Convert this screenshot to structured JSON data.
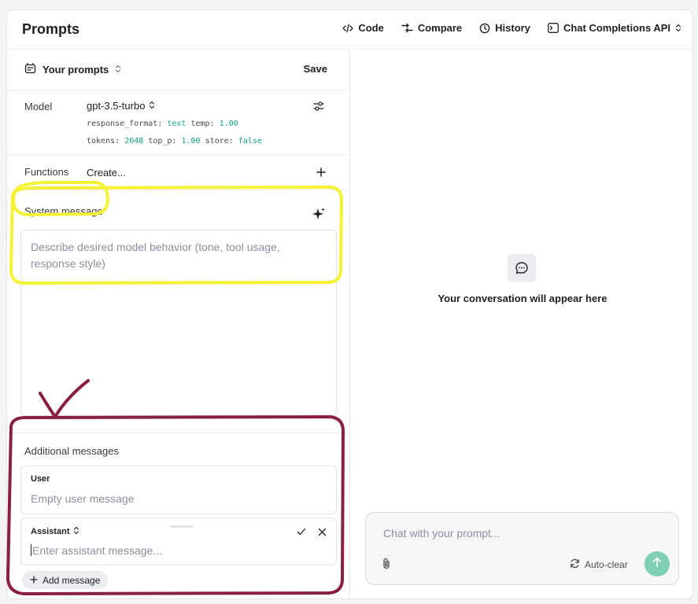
{
  "app": {
    "title": "Prompts"
  },
  "toolbar": {
    "code_label": "Code",
    "compare_label": "Compare",
    "history_label": "History",
    "api_label": "Chat Completions API"
  },
  "prompts": {
    "your_prompts_label": "Your prompts",
    "save_label": "Save"
  },
  "model": {
    "label": "Model",
    "value": "gpt-3.5-turbo",
    "params": {
      "response_format_key": "response_format:",
      "response_format_val": "text",
      "temp_key": "temp:",
      "temp_val": "1.00",
      "tokens_key": "tokens:",
      "tokens_val": "2048",
      "top_p_key": "top_p:",
      "top_p_val": "1.00",
      "store_key": "store:",
      "store_val": "false"
    }
  },
  "functions": {
    "label": "Functions",
    "create_label": "Create..."
  },
  "system": {
    "label": "System message",
    "placeholder": "Describe desired model behavior (tone, tool usage, response style)"
  },
  "additional": {
    "title": "Additional messages",
    "user": {
      "role": "User",
      "placeholder": "Empty user message"
    },
    "assistant": {
      "role": "Assistant",
      "placeholder": "Enter assistant message..."
    },
    "add_label": "Add message"
  },
  "chat": {
    "empty_text": "Your conversation will appear here",
    "input_placeholder": "Chat with your prompt...",
    "autoclear_label": "Auto-clear"
  },
  "colors": {
    "accent": "#10a37f",
    "send_button": "#7fcfb4",
    "highlight_yellow": "#f5f236",
    "highlight_maroon": "#8a1f45"
  }
}
